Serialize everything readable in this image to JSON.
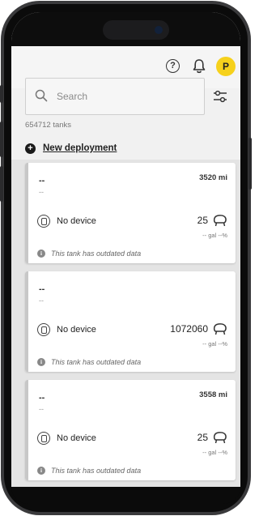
{
  "header": {
    "help_icon": "question-icon",
    "bell_icon": "bell-icon",
    "avatar_initial": "P"
  },
  "search": {
    "placeholder": "Search",
    "value": ""
  },
  "tank_count": "654712 tanks",
  "new_deployment_label": "New deployment",
  "cards": [
    {
      "name": "--",
      "subtitle": "--",
      "distance": "3520 mi",
      "device_label": "No device",
      "level": "25",
      "units": "-- gal  --%",
      "note": "This tank has outdated data"
    },
    {
      "name": "--",
      "subtitle": "--",
      "distance": "",
      "device_label": "No device",
      "level": "1072060",
      "units": "-- gal  --%",
      "note": "This tank has outdated data"
    },
    {
      "name": "--",
      "subtitle": "--",
      "distance": "3558 mi",
      "device_label": "No device",
      "level": "25",
      "units": "-- gal  --%",
      "note": "This tank has outdated data"
    }
  ],
  "colors": {
    "avatar": "#f6d11c",
    "accent": "#1a1a1a"
  }
}
